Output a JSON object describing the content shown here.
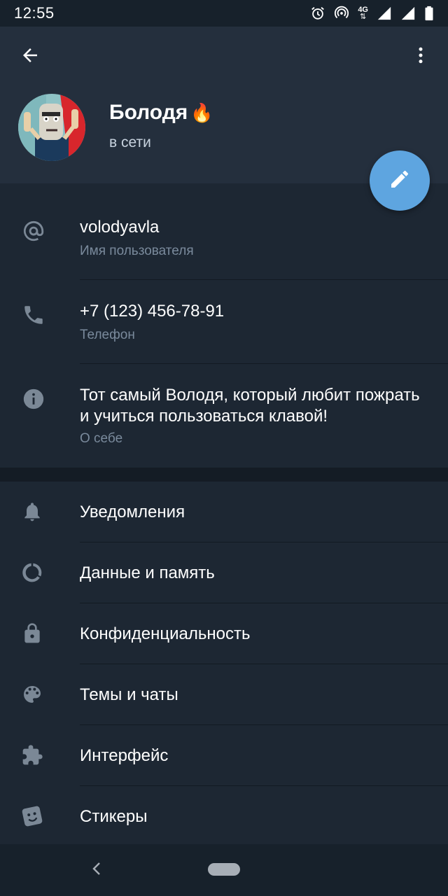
{
  "status_bar": {
    "time": "12:55",
    "network": "4G",
    "icons": [
      "alarm-icon",
      "hotspot-icon",
      "network-4g-icon",
      "signal-icon",
      "signal-icon",
      "battery-icon"
    ]
  },
  "header": {
    "back_icon": "arrow-left-icon",
    "menu_icon": "more-vert-icon",
    "name": "Болодя",
    "name_emoji": "🔥",
    "status": "в сети",
    "edit_icon": "pencil-icon"
  },
  "info": {
    "username": {
      "value": "volodyavla",
      "label": "Имя пользователя",
      "icon": "at-icon"
    },
    "phone": {
      "value": "+7 (123) 456-78-91",
      "label": "Телефон",
      "icon": "phone-icon"
    },
    "bio": {
      "line1": "Тот самый Володя, который любит пожрать",
      "line2": "и учиться пользоваться клавой!",
      "label": "О себе",
      "icon": "info-icon"
    }
  },
  "settings": {
    "items": [
      {
        "label": "Уведомления",
        "icon": "bell-icon"
      },
      {
        "label": "Данные и память",
        "icon": "data-circle-icon"
      },
      {
        "label": "Конфиденциальность",
        "icon": "lock-icon"
      },
      {
        "label": "Темы и чаты",
        "icon": "palette-icon"
      },
      {
        "label": "Интерфейс",
        "icon": "puzzle-icon"
      },
      {
        "label": "Стикеры",
        "icon": "sticker-icon"
      }
    ]
  },
  "colors": {
    "header_bg": "#242f3d",
    "body_bg": "#1d2733",
    "accent": "#5ea5e0",
    "secondary_text": "#7a8a9c",
    "icon": "#7b8896"
  }
}
